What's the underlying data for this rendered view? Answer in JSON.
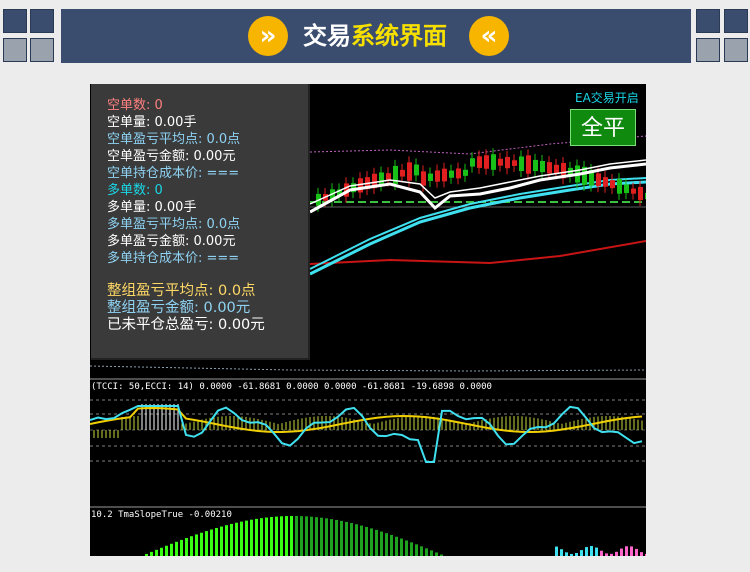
{
  "header": {
    "title_white": "交易",
    "title_yellow": "系统界面",
    "left_icon": "double-chevron-right-icon",
    "right_icon": "double-chevron-left-icon",
    "accent": "#f7b500",
    "bar_color": "#3a4d6e"
  },
  "panel": {
    "lines": [
      {
        "text": "空单数: 0",
        "color": "#ff8080"
      },
      {
        "text": "空单量: 0.00手",
        "color": "#ffffff"
      },
      {
        "text": "空单盈亏平均点: 0.0点",
        "color": "#8fd3f4"
      },
      {
        "text": "空单盈亏金额: 0.00元",
        "color": "#ffffff"
      },
      {
        "text": "空单持仓成本价: ===",
        "color": "#8fd3f4"
      },
      {
        "text": "多单数: 0",
        "color": "#19d7e6"
      },
      {
        "text": "多单量: 0.00手",
        "color": "#ffffff"
      },
      {
        "text": "多单盈亏平均点: 0.0点",
        "color": "#8fd3f4"
      },
      {
        "text": "多单盈亏金额: 0.00元",
        "color": "#ffffff"
      },
      {
        "text": "多单持仓成本价: ===",
        "color": "#8fd3f4"
      }
    ],
    "summary": [
      {
        "text": "整组盈亏平均点: 0.0点",
        "color": "#ffd966"
      },
      {
        "text": "整组盈亏金额: 0.00元",
        "color": "#8fd3f4"
      },
      {
        "text": "已未平仓总盈亏: 0.00元",
        "color": "#ffffff"
      }
    ]
  },
  "ea_status": "EA交易开启",
  "close_all_label": "全平",
  "cci_label": "(TCCI: 50,ECCI: 14) 0.0000 -61.8681 0.0000 0.0000 -61.8681 -19.6898 0.0000",
  "tma_label": "10.2 TmaSlopeTrue -0.00210",
  "colors": {
    "bull": "#18c018",
    "bear": "#e02020",
    "ma_cyan": "#3fe0f0",
    "ma_white": "#ffffff",
    "ma_red": "#c81414",
    "cci_yellow": "#f0d000"
  }
}
